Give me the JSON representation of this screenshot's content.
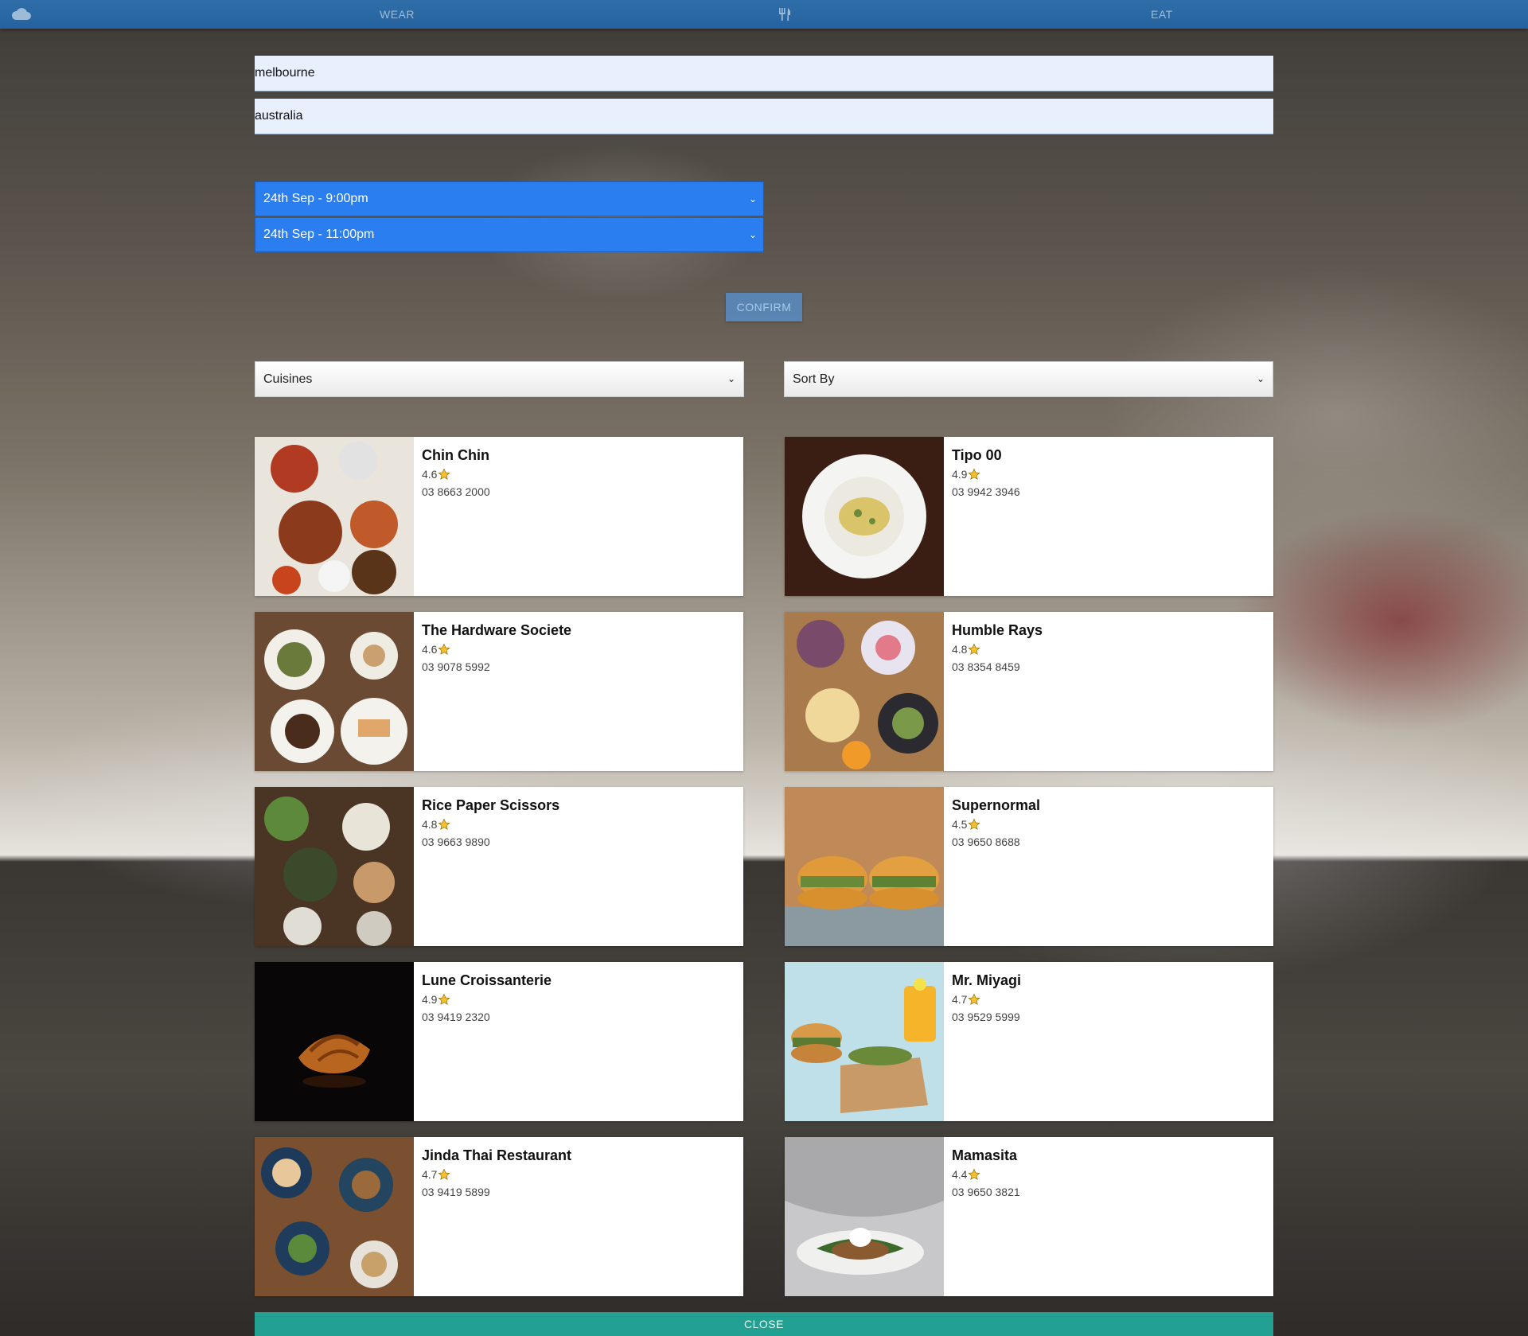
{
  "nav": {
    "wear_label": "WEAR",
    "eat_label": "EAT",
    "color": "#2a66a3"
  },
  "search": {
    "city_value": "melbourne",
    "country_value": "australia"
  },
  "dates": {
    "start": "24th Sep - 9:00pm",
    "end": "24th Sep - 11:00pm"
  },
  "confirm_label": "CONFIRM",
  "filters": {
    "cuisines": "Cuisines",
    "sort_by": "Sort By"
  },
  "restaurants": [
    {
      "name": "Chin Chin",
      "rating": "4.6",
      "phone": "03 8663 2000"
    },
    {
      "name": "Tipo 00",
      "rating": "4.9",
      "phone": "03 9942 3946"
    },
    {
      "name": "The Hardware Societe",
      "rating": "4.6",
      "phone": "03 9078 5992"
    },
    {
      "name": "Humble Rays",
      "rating": "4.8",
      "phone": "03 8354 8459"
    },
    {
      "name": "Rice Paper Scissors",
      "rating": "4.8",
      "phone": "03 9663 9890"
    },
    {
      "name": "Supernormal",
      "rating": "4.5",
      "phone": "03 9650 8688"
    },
    {
      "name": "Lune Croissanterie",
      "rating": "4.9",
      "phone": "03 9419 2320"
    },
    {
      "name": "Mr. Miyagi",
      "rating": "4.7",
      "phone": "03 9529 5999"
    },
    {
      "name": "Jinda Thai Restaurant",
      "rating": "4.7",
      "phone": "03 9419 5899"
    },
    {
      "name": "Mamasita",
      "rating": "4.4",
      "phone": "03 9650 3821"
    }
  ],
  "close_label": "CLOSE",
  "colors": {
    "select_blue": "#2a7ef0",
    "close_teal": "#22a091",
    "star_gold": "#f6c12d"
  }
}
